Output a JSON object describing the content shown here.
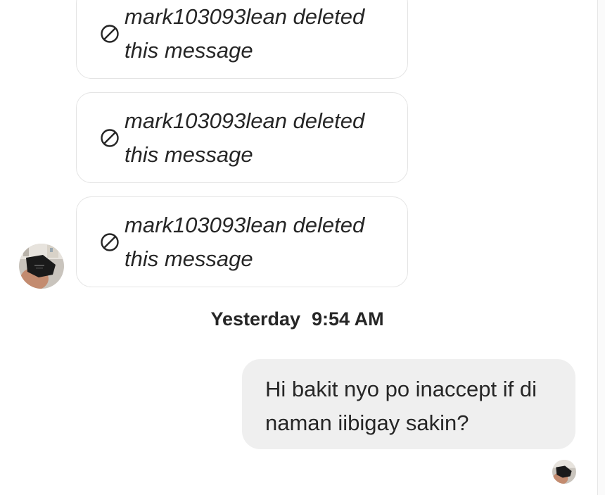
{
  "thread": {
    "deleted_messages": [
      {
        "text": "mark103093lean deleted this message",
        "icon": "ban-icon"
      },
      {
        "text": "mark103093lean deleted this message",
        "icon": "ban-icon"
      },
      {
        "text": "mark103093lean deleted this message",
        "icon": "ban-icon"
      }
    ],
    "timestamp": {
      "day": "Yesterday",
      "time": "9:54 AM"
    },
    "sent_message": {
      "text": "Hi bakit nyo po inaccept if di naman iibigay sakin?"
    }
  },
  "colors": {
    "text": "#262626",
    "bubble_border": "#e4e4e4",
    "sent_bubble_bg": "#efefef",
    "background": "#ffffff"
  }
}
